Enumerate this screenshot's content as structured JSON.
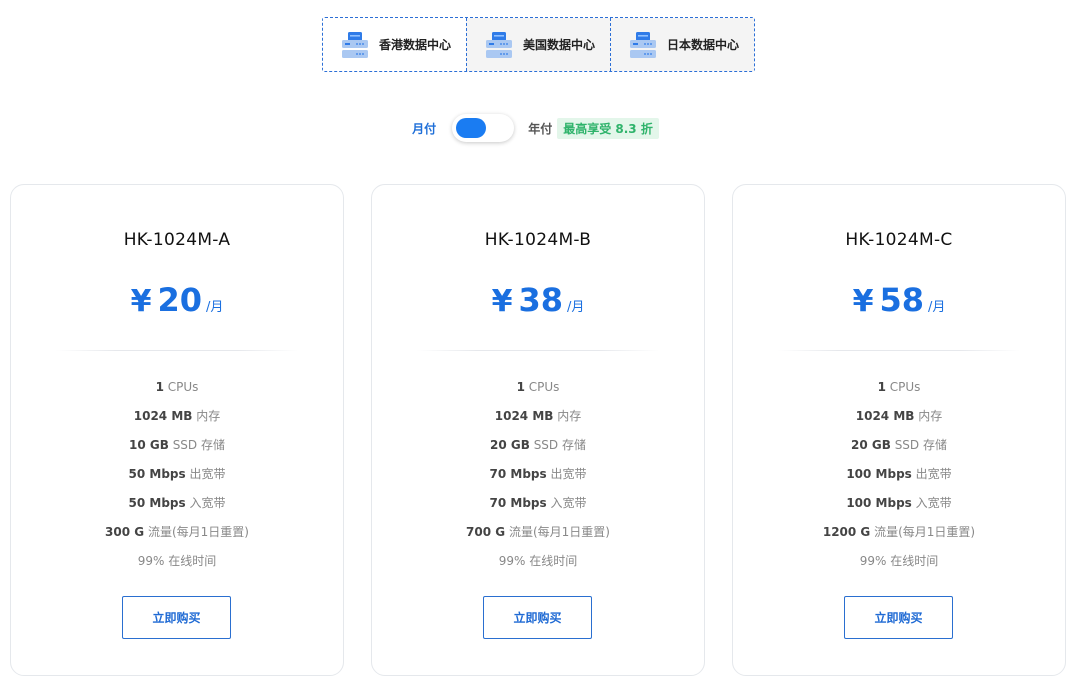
{
  "datacenters": [
    {
      "label": "香港数据中心",
      "icon": "server-icon",
      "active": true
    },
    {
      "label": "美国数据中心",
      "icon": "server-icon",
      "active": false
    },
    {
      "label": "日本数据中心",
      "icon": "server-icon",
      "active": false
    }
  ],
  "billing": {
    "monthly_label": "月付",
    "yearly_label": "年付",
    "discount_badge": "最高享受 8.3 折",
    "selected": "monthly"
  },
  "plans": [
    {
      "name": "HK-1024M-A",
      "currency": "¥",
      "price": "20",
      "period": "/月",
      "specs": [
        {
          "value": "1",
          "unit": " CPUs"
        },
        {
          "value": "1024 MB",
          "unit": " 内存"
        },
        {
          "value": "10 GB",
          "unit": " SSD 存储"
        },
        {
          "value": "50 Mbps",
          "unit": " 出宽带"
        },
        {
          "value": "50 Mbps",
          "unit": " 入宽带"
        },
        {
          "value": "300 G",
          "unit": " 流量(每月1日重置)"
        },
        {
          "value": "",
          "unit": "99% 在线时间"
        }
      ],
      "buy_label": "立即购买"
    },
    {
      "name": "HK-1024M-B",
      "currency": "¥",
      "price": "38",
      "period": "/月",
      "specs": [
        {
          "value": "1",
          "unit": " CPUs"
        },
        {
          "value": "1024 MB",
          "unit": " 内存"
        },
        {
          "value": "20 GB",
          "unit": " SSD 存储"
        },
        {
          "value": "70 Mbps",
          "unit": " 出宽带"
        },
        {
          "value": "70 Mbps",
          "unit": " 入宽带"
        },
        {
          "value": "700 G",
          "unit": " 流量(每月1日重置)"
        },
        {
          "value": "",
          "unit": "99% 在线时间"
        }
      ],
      "buy_label": "立即购买"
    },
    {
      "name": "HK-1024M-C",
      "currency": "¥",
      "price": "58",
      "period": "/月",
      "specs": [
        {
          "value": "1",
          "unit": " CPUs"
        },
        {
          "value": "1024 MB",
          "unit": " 内存"
        },
        {
          "value": "20 GB",
          "unit": " SSD 存储"
        },
        {
          "value": "100 Mbps",
          "unit": " 出宽带"
        },
        {
          "value": "100 Mbps",
          "unit": " 入宽带"
        },
        {
          "value": "1200 G",
          "unit": " 流量(每月1日重置)"
        },
        {
          "value": "",
          "unit": "99% 在线时间"
        }
      ],
      "buy_label": "立即购买"
    }
  ],
  "colors": {
    "accent": "#1a6fe0",
    "toggle": "#1a7cf2",
    "discount_text": "#2fb36b",
    "discount_bg": "#e3f6ea",
    "border_dashed": "#2c6fd6"
  }
}
